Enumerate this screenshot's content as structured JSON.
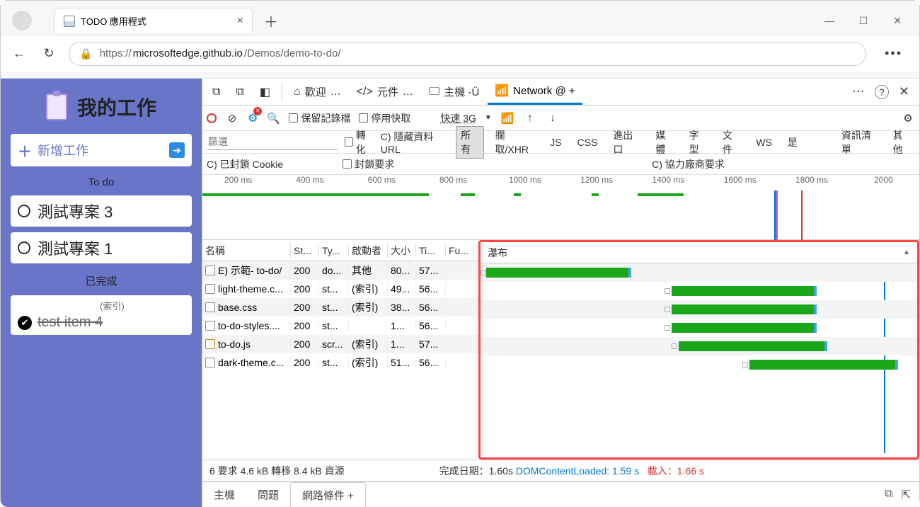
{
  "browser": {
    "tab_title": "TODO 應用程式",
    "url_prefix": "https://",
    "url_host": "microsoftedge.github.io",
    "url_path": "/Demos/demo-to-do/"
  },
  "todo": {
    "title": "我的工作",
    "add_label": "新增工作",
    "section_todo": "To do",
    "section_done": "已完成",
    "tasks": [
      "測試專案 3",
      "測試專案 1"
    ],
    "done_task": "test item 4",
    "done_sub": "(索引)"
  },
  "devtools": {
    "tabs": {
      "welcome": "歡迎",
      "elements": "元件",
      "host": "主機 -Ü",
      "network": "Network @ +"
    },
    "more": "…",
    "toolbar": {
      "preserve_log": "保留記錄檔",
      "disable_cache": "停用快取",
      "throttle": "快速 3G"
    },
    "filter": {
      "placeholder": "篩選",
      "invert": "轉化",
      "hide_data": "C) 隱藏資料 URL",
      "all": "所有",
      "fetch": "攔取/XHR",
      "js": "JS",
      "css": "CSS",
      "import": "進出口",
      "media": "媒體",
      "font": "字型",
      "doc": "文件",
      "ws": "WS",
      "yes": "是",
      "manifest": "資訊清單",
      "other": "其他"
    },
    "cookie": {
      "blocked": "C) 已封鎖 Cookie",
      "block_req": "封鎖要求",
      "third_party": "C) 協力廠商要求"
    },
    "ruler": [
      "200 ms",
      "400 ms",
      "600 ms",
      "800 ms",
      "1000 ms",
      "1200 ms",
      "1400 ms",
      "1600 ms",
      "1800 ms",
      "2000"
    ],
    "columns": {
      "name": "名稱",
      "status": "St...",
      "type": "Ty...",
      "initiator": "啟動者",
      "size": "大小",
      "time": "Ti...",
      "fu": "Fu...",
      "waterfall": "瀑布"
    },
    "rows": [
      {
        "name": "E) 示範- to-do/",
        "status": "200",
        "type": "do...",
        "initiator": "其他",
        "size": "80...",
        "time": "57...",
        "fu": ""
      },
      {
        "name": "light-theme.c...",
        "status": "200",
        "type": "st...",
        "initiator": "(索引)",
        "size": "49...",
        "time": "56...",
        "fu": ""
      },
      {
        "name": "base.css",
        "status": "200",
        "type": "st...",
        "initiator": "(索引)",
        "size": "38...",
        "time": "56...",
        "fu": ""
      },
      {
        "name": "to-do-styles....",
        "status": "200",
        "type": "st...",
        "initiator": "",
        "size": "1...",
        "time": "56...",
        "fu": ""
      },
      {
        "name": "to-do.js",
        "status": "200",
        "type": "scr...",
        "initiator": "(索引)",
        "size": "1...",
        "time": "57...",
        "fu": ""
      },
      {
        "name": "dark-theme.c...",
        "status": "200",
        "type": "st...",
        "initiator": "(索引)",
        "size": "51...",
        "time": "56...",
        "fu": ""
      }
    ],
    "status": {
      "summary": "6 要求 4.6 kB 轉移 8.4 kB 資源",
      "finish": "完成日期：1.60s",
      "dom": "DOMContentLoaded: 1.59 s",
      "load": "載入：1.66 s"
    },
    "drawer": {
      "host": "主機",
      "issues": "問題",
      "netcond": "網路條件 +"
    }
  }
}
